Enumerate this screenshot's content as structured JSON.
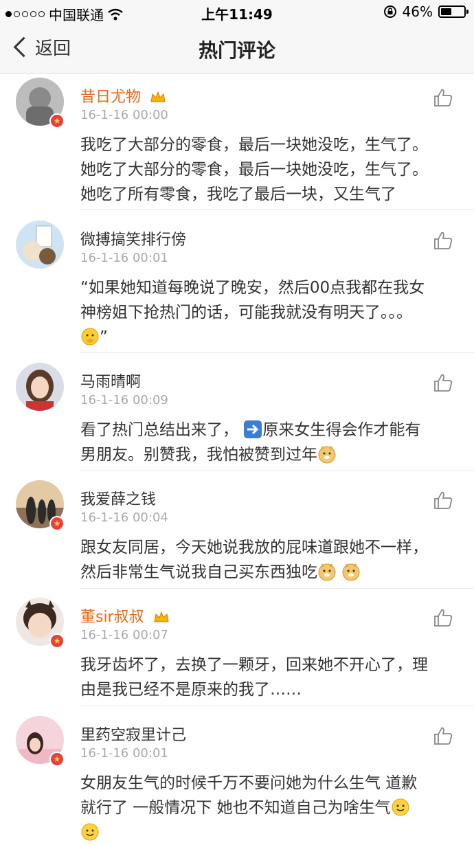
{
  "status_bar": {
    "carrier": "中国联通",
    "time": "上午11:49",
    "battery": "46%",
    "battery_level": 0.46
  },
  "nav": {
    "back_label": "返回",
    "title": "热门评论"
  },
  "comments": [
    {
      "user": "昔日尤物",
      "time": "16-1-16 00:00",
      "lines": [
        "我吃了大部分的零食，最后一块她没吃，生气了。",
        "她吃了大部分的零食，最后一块她没吃，生气了。",
        "她吃了所有零食，我吃了最后一块，又生气了"
      ]
    },
    {
      "user": "微搏搞笑排行傍",
      "time": "16-1-16 00:01",
      "lines": [
        "“如果她知道每晚说了晚安，然后00点我都在我女",
        "神榜姐下抢热门的话，可能我就没有明天了。。。",
        "”"
      ]
    },
    {
      "user": "马雨晴啊",
      "time": "16-1-16 00:09",
      "lines": [
        "看了热门总结出来了，",
        "原来女生得会作才能有",
        "男朋友。别赞我，我怕被赞到过年"
      ]
    },
    {
      "user": "我爱薛之钱",
      "time": "16-1-16 00:04",
      "lines": [
        "跟女友同居，今天她说我放的屁味道跟她不一样，",
        "然后非常生气说我自己买东西独吃"
      ]
    },
    {
      "user": "董sir叔叔",
      "time": "16-1-16 00:07",
      "lines": [
        "我牙齿坏了，去换了一颗牙，回来她不开心了，理",
        "由是我已经不是原来的我了……"
      ]
    },
    {
      "user": "里药空寂里计己",
      "time": "16-1-16 00:01",
      "lines": [
        "女朋友生气的时候千万不要问她为什么生气 道歉",
        "就行了 一般情况下 她也不知道自己为啥生气"
      ]
    }
  ],
  "icons": {
    "like": "thumbs-up-icon",
    "verified": "verified-badge-icon",
    "vip": "crown-icon"
  },
  "colors": {
    "vip_name": "#e86a1c",
    "timestamp": "#aaaaaa",
    "badge": "#e8413b"
  }
}
